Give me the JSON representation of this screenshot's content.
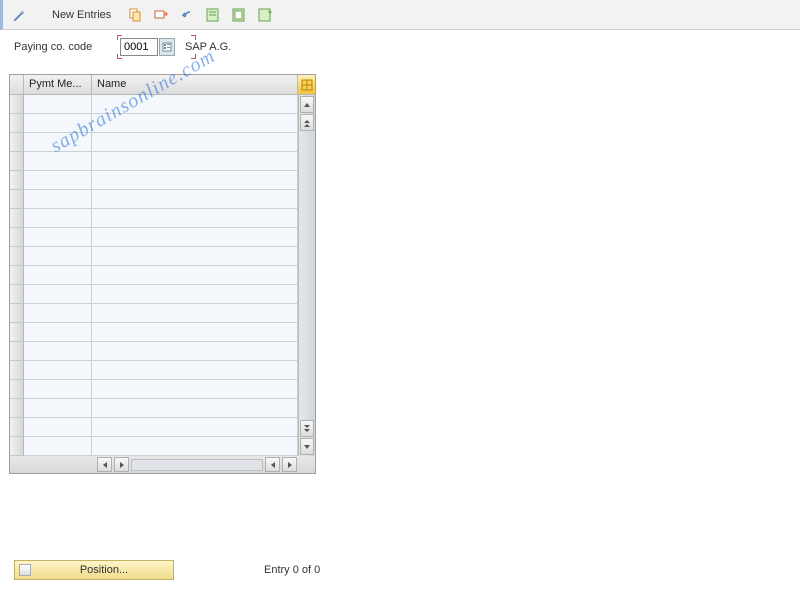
{
  "toolbar": {
    "new_entries_label": "New Entries"
  },
  "field": {
    "label": "Paying co. code",
    "value": "0001",
    "description": "SAP A.G."
  },
  "table": {
    "columns": {
      "pymt_meth": "Pymt Me...",
      "name": "Name"
    },
    "rows": [
      {
        "pymt": "",
        "name": ""
      },
      {
        "pymt": "",
        "name": ""
      },
      {
        "pymt": "",
        "name": ""
      },
      {
        "pymt": "",
        "name": ""
      },
      {
        "pymt": "",
        "name": ""
      },
      {
        "pymt": "",
        "name": ""
      },
      {
        "pymt": "",
        "name": ""
      },
      {
        "pymt": "",
        "name": ""
      },
      {
        "pymt": "",
        "name": ""
      },
      {
        "pymt": "",
        "name": ""
      },
      {
        "pymt": "",
        "name": ""
      },
      {
        "pymt": "",
        "name": ""
      },
      {
        "pymt": "",
        "name": ""
      },
      {
        "pymt": "",
        "name": ""
      },
      {
        "pymt": "",
        "name": ""
      },
      {
        "pymt": "",
        "name": ""
      },
      {
        "pymt": "",
        "name": ""
      },
      {
        "pymt": "",
        "name": ""
      },
      {
        "pymt": "",
        "name": ""
      }
    ]
  },
  "footer": {
    "position_label": "Position...",
    "entry_text": "Entry 0 of 0"
  },
  "watermark": "sapbrainsonline.com"
}
